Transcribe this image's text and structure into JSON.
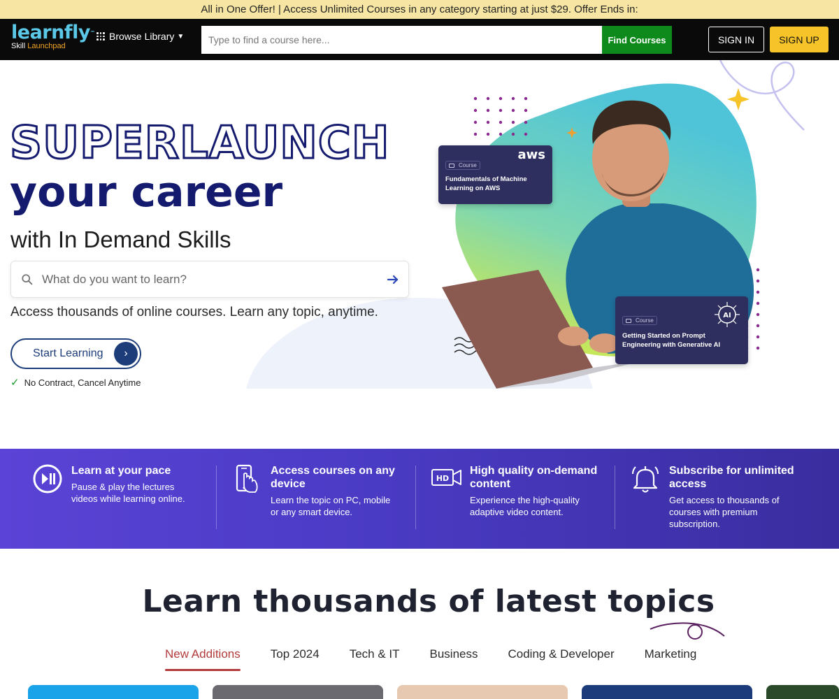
{
  "offer": {
    "text": "All in One Offer! | Access Unlimited Courses in any category starting at just $29. Offer Ends in:"
  },
  "header": {
    "logo_word": "learnfly",
    "logo_tm": "™",
    "logo_sub_a": "Skill",
    "logo_sub_b": "Launchpad",
    "browse_label": "Browse Library",
    "search_placeholder": "Type to find a course here...",
    "find_label": "Find Courses",
    "signin_label": "SIGN IN",
    "signup_label": "SIGN UP",
    "colors": {
      "bg": "#0a0a0a",
      "find": "#0e8a1d",
      "signup": "#f6c428"
    }
  },
  "hero": {
    "headline_outline": "SUPERLAUNCH",
    "headline_solid": "your career",
    "subheadline": "with In Demand Skills",
    "search_placeholder": "What do you want to learn?",
    "tagline": "Access thousands of online courses. Learn any topic, anytime.",
    "cta_label": "Start Learning",
    "no_contract": "No Contract, Cancel Anytime",
    "cards": [
      {
        "tag": "Course",
        "title_line1": "Fundamentals of Machine",
        "title_line2": "Learning on AWS",
        "logo": "aws"
      },
      {
        "tag": "Course",
        "title_line1": "Getting Started on Prompt",
        "title_line2": "Engineering with Generative AI",
        "logo": "AI"
      }
    ]
  },
  "features": [
    {
      "icon": "play-pause-icon",
      "title_line1": "Learn at your pace",
      "title_line2": "",
      "desc_line1": "Pause & play the lectures",
      "desc_line2": "videos while learning online.",
      "desc_line3": ""
    },
    {
      "icon": "mobile-touch-icon",
      "title_line1": "Access courses on any",
      "title_line2": "device",
      "desc_line1": "Learn the topic on PC, mobile",
      "desc_line2": "or any smart device.",
      "desc_line3": ""
    },
    {
      "icon": "hd-video-icon",
      "title_line1": "High quality on-demand",
      "title_line2": "content",
      "desc_line1": "Experience the high-quality",
      "desc_line2": "adaptive video content.",
      "desc_line3": ""
    },
    {
      "icon": "bell-icon",
      "title_line1": "Subscribe for unlimited",
      "title_line2": "access",
      "desc_line1": "Get access to thousands of",
      "desc_line2": "courses with premium",
      "desc_line3": "subscription."
    }
  ],
  "learn": {
    "title": "Learn thousands of latest topics",
    "tabs": [
      "New Additions",
      "Top 2024",
      "Tech & IT",
      "Business",
      "Coding & Developer",
      "Marketing"
    ],
    "active_tab": "New Additions"
  }
}
